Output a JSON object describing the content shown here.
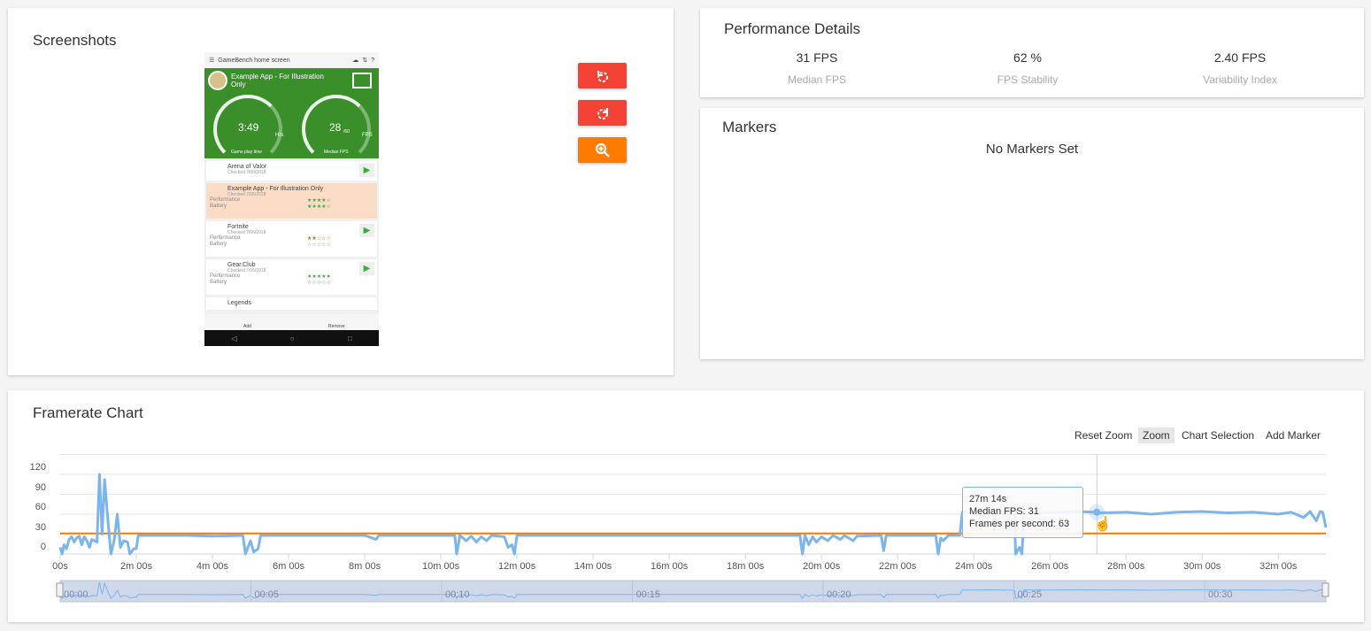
{
  "screenshots": {
    "title": "Screenshots",
    "buttons": [
      {
        "label": "rotate-left",
        "icon": "rotate-left-icon",
        "color": "#f44336"
      },
      {
        "label": "rotate-right",
        "icon": "rotate-right-icon",
        "color": "#f44336"
      },
      {
        "label": "zoom-in",
        "icon": "zoom-in-icon",
        "color": "#ff7b00"
      }
    ],
    "phone": {
      "header": "GameBench home screen",
      "app_title": "Example App - For Illustration Only",
      "time_value": "3:49",
      "time_unit": "Hrs",
      "time_label": "Game play time",
      "fps_value": "28",
      "fps_max": "/60",
      "fps_unit": "FPS",
      "fps_label": "Median FPS",
      "items": [
        {
          "name": "Arena of Valor",
          "sub": "Checked 7/06/2018"
        },
        {
          "name": "Example App - For Illustration Only",
          "sub": "Checked 7/06/2018",
          "l1": "Performance",
          "l2": "Battery",
          "s1": "★★★★☆",
          "s2": "★★★★☆"
        },
        {
          "name": "Fortnite",
          "sub": "Checked 7/06/2018",
          "l1": "Performance",
          "l2": "Battery",
          "s1": "★★☆☆☆",
          "s2": "☆☆☆☆☆"
        },
        {
          "name": "Gear.Club",
          "sub": "Checked 7/06/2018",
          "l1": "Performance",
          "l2": "Battery",
          "s1": "★★★★★",
          "s2": "☆☆☆☆☆"
        },
        {
          "name": "Legends",
          "sub": ""
        }
      ],
      "add_label": "Add",
      "remove_label": "Remove"
    }
  },
  "performance": {
    "title": "Performance Details",
    "stats": [
      {
        "value": "31 FPS",
        "label": "Median FPS"
      },
      {
        "value": "62 %",
        "label": "FPS Stability"
      },
      {
        "value": "2.40 FPS",
        "label": "Variability Index"
      }
    ]
  },
  "markers": {
    "title": "Markers",
    "empty": "No Markers Set"
  },
  "framerate": {
    "title": "Framerate Chart",
    "toolbar": [
      "Reset Zoom",
      "Zoom",
      "Chart Selection",
      "Add Marker"
    ],
    "active_tool": "Zoom",
    "tooltip": {
      "time": "27m 14s",
      "median": "Median FPS: 31",
      "fps": "Frames per second: 63"
    },
    "navigator_labels": [
      "00:00",
      "00:05",
      "00:10",
      "00:15",
      "00:20",
      "00:25",
      "00:30"
    ]
  },
  "chart_data": {
    "type": "line",
    "xlabel": "",
    "ylabel": "",
    "ylim": [
      0,
      150
    ],
    "xlim_seconds": [
      0,
      1995
    ],
    "yticks": [
      "0",
      "30",
      "60",
      "90",
      "120"
    ],
    "xticks": [
      "00s",
      "2m 00s",
      "4m 00s",
      "6m 00s",
      "8m 00s",
      "10m 00s",
      "12m 00s",
      "14m 00s",
      "16m 00s",
      "18m 00s",
      "20m 00s",
      "22m 00s",
      "24m 00s",
      "26m 00s",
      "28m 00s",
      "30m 00s",
      "32m 00s"
    ],
    "grid": true,
    "median_fps": 31,
    "colors": {
      "series": "#7cb5ec",
      "median": "#f57c00"
    },
    "series": [
      {
        "name": "Frames per second",
        "points": [
          [
            0,
            10
          ],
          [
            3,
            0
          ],
          [
            6,
            14
          ],
          [
            10,
            8
          ],
          [
            14,
            22
          ],
          [
            18,
            26
          ],
          [
            22,
            18
          ],
          [
            26,
            24
          ],
          [
            30,
            27
          ],
          [
            34,
            14
          ],
          [
            38,
            26
          ],
          [
            42,
            20
          ],
          [
            46,
            10
          ],
          [
            50,
            22
          ],
          [
            54,
            20
          ],
          [
            58,
            18
          ],
          [
            62,
            120
          ],
          [
            66,
            30
          ],
          [
            70,
            112
          ],
          [
            74,
            65
          ],
          [
            80,
            0
          ],
          [
            85,
            20
          ],
          [
            90,
            60
          ],
          [
            95,
            10
          ],
          [
            100,
            20
          ],
          [
            106,
            18
          ],
          [
            110,
            0
          ],
          [
            116,
            8
          ],
          [
            120,
            8
          ],
          [
            123,
            28
          ],
          [
            200,
            28
          ],
          [
            240,
            27
          ],
          [
            288,
            28
          ],
          [
            292,
            0
          ],
          [
            300,
            20
          ],
          [
            305,
            3
          ],
          [
            312,
            8
          ],
          [
            316,
            28
          ],
          [
            480,
            28
          ],
          [
            498,
            22
          ],
          [
            502,
            28
          ],
          [
            622,
            28
          ],
          [
            625,
            0
          ],
          [
            630,
            28
          ],
          [
            640,
            20
          ],
          [
            648,
            27
          ],
          [
            656,
            18
          ],
          [
            664,
            26
          ],
          [
            672,
            20
          ],
          [
            680,
            28
          ],
          [
            700,
            26
          ],
          [
            706,
            10
          ],
          [
            712,
            14
          ],
          [
            716,
            0
          ],
          [
            720,
            28
          ],
          [
            1166,
            28
          ],
          [
            1170,
            0
          ],
          [
            1174,
            28
          ],
          [
            1180,
            14
          ],
          [
            1186,
            26
          ],
          [
            1192,
            18
          ],
          [
            1200,
            26
          ],
          [
            1210,
            20
          ],
          [
            1218,
            28
          ],
          [
            1230,
            22
          ],
          [
            1236,
            28
          ],
          [
            1250,
            20
          ],
          [
            1256,
            27
          ],
          [
            1294,
            28
          ],
          [
            1298,
            5
          ],
          [
            1302,
            28
          ],
          [
            1380,
            28
          ],
          [
            1384,
            0
          ],
          [
            1388,
            24
          ],
          [
            1392,
            20
          ],
          [
            1400,
            28
          ],
          [
            1418,
            28
          ],
          [
            1422,
            63
          ],
          [
            1440,
            62
          ],
          [
            1460,
            64
          ],
          [
            1480,
            63
          ],
          [
            1504,
            60
          ],
          [
            1506,
            0
          ],
          [
            1512,
            10
          ],
          [
            1516,
            0
          ],
          [
            1519,
            63
          ],
          [
            1560,
            62
          ],
          [
            1600,
            64
          ],
          [
            1634,
            63
          ],
          [
            1640,
            62
          ],
          [
            1680,
            63
          ],
          [
            1720,
            60
          ],
          [
            1760,
            63
          ],
          [
            1800,
            64
          ],
          [
            1840,
            62
          ],
          [
            1880,
            63
          ],
          [
            1920,
            60
          ],
          [
            1940,
            63
          ],
          [
            1960,
            55
          ],
          [
            1970,
            64
          ],
          [
            1980,
            50
          ],
          [
            1986,
            64
          ],
          [
            1990,
            63
          ],
          [
            1995,
            40
          ]
        ]
      }
    ]
  }
}
